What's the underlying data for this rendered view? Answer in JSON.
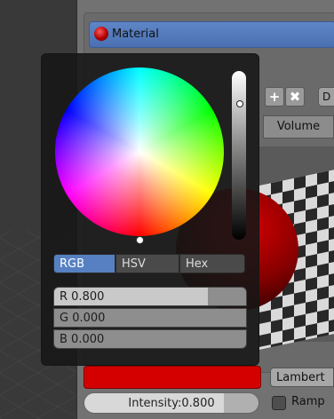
{
  "material": {
    "label": "Material"
  },
  "tabs": {
    "volume": "Volume"
  },
  "slot_buttons": {
    "add": "+",
    "remove": "✖",
    "extra": "D"
  },
  "diffuse": {
    "color": "#d40000",
    "shader": "Lambert",
    "intensity_label": "Intensity:0.800",
    "intensity": 0.8,
    "ramp_label": "Ramp"
  },
  "picker": {
    "modes": [
      "RGB",
      "HSV",
      "Hex"
    ],
    "active_mode": "RGB",
    "channels": [
      {
        "label": "R 0.800",
        "value": 0.8
      },
      {
        "label": "G 0.000",
        "value": 0.0
      },
      {
        "label": "B 0.000",
        "value": 0.0
      }
    ]
  },
  "colors": {
    "accent": "#5680c2",
    "material_red": "#d40000"
  }
}
